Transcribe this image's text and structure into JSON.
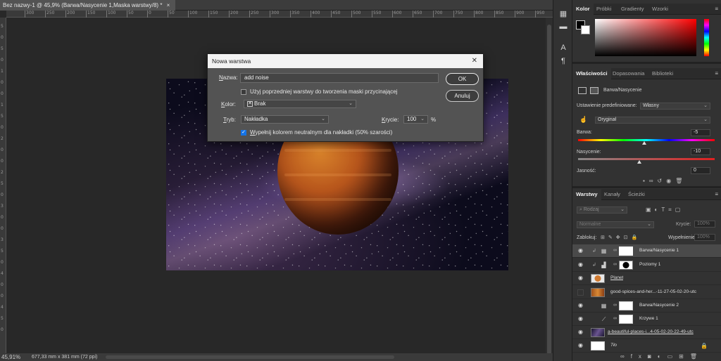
{
  "document": {
    "tab_title": "Bez nazwy-1 @ 45,9% (Barwa/Nasycenie 1,Maska warstwy/8) *",
    "tab_close": "×",
    "ruler_h": [
      "300",
      "250",
      "200",
      "150",
      "100",
      "50",
      "0",
      "50",
      "100",
      "150",
      "200",
      "250",
      "300",
      "350",
      "400",
      "450",
      "500",
      "550",
      "600",
      "650",
      "700",
      "750",
      "800",
      "850",
      "900",
      "950"
    ],
    "ruler_v": [
      "5",
      "0",
      "5",
      "0",
      "1",
      "0",
      "0",
      "1",
      "5",
      "0",
      "2",
      "0",
      "0",
      "2",
      "5",
      "0",
      "3",
      "0",
      "0",
      "3",
      "5",
      "0",
      "4",
      "0",
      "0",
      "4",
      "5",
      "0"
    ],
    "zoom": "45,91%",
    "doc_size": "677,33 mm x 381 mm (72 ppi)"
  },
  "dialog": {
    "title": "Nowa warstwa",
    "close": "✕",
    "name_label_u": "N",
    "name_label_rest": "azwa:",
    "name_value": "add noise",
    "clip_checkbox_label": "Użyj poprzedniej warstwy do tworzenia maski przycinającej",
    "color_label_u": "K",
    "color_label_rest": "olor:",
    "color_value": "Brak",
    "mode_label_u": "T",
    "mode_label_rest": "ryb:",
    "mode_value": "Nakładka",
    "opacity_label_u": "K",
    "opacity_label_rest": "rycie:",
    "opacity_value": "100",
    "opacity_unit": "%",
    "fill_checkbox_u": "W",
    "fill_checkbox_rest": "ypełnij kolorem neutralnym dla nakładki (50% szarości)",
    "ok": "OK",
    "cancel": "Anuluj"
  },
  "color_panel": {
    "tabs": [
      "Kolor",
      "Próbki",
      "Gradienty",
      "Wzorki"
    ]
  },
  "properties_panel": {
    "tabs": [
      "Właściwości",
      "Dopasowania",
      "Biblioteki"
    ],
    "layer_type": "Barwa/Nasycenie",
    "preset_label": "Ustawienie predefiniowane:",
    "preset_value": "Własny",
    "channel_value": "Oryginał",
    "hue_label": "Barwa:",
    "hue_value": "-5",
    "hue_level": -5,
    "sat_label": "Nasycenie:",
    "sat_value": "-10",
    "sat_level": -10,
    "light_label": "Jasność:",
    "light_value": "0"
  },
  "layers_panel": {
    "tabs": [
      "Warstwy",
      "Kanały",
      "Ścieżki"
    ],
    "filter_placeholder": "Rodzaj",
    "blend_mode": "Normalne",
    "opacity_label": "Krycie:",
    "opacity_value": "100%",
    "lock_label": "Zablokuj:",
    "fill_label": "Wypełnienie:",
    "fill_value": "100%",
    "layers": [
      {
        "name": "Barwa/Nasycenie 1",
        "visible": true,
        "selected": true
      },
      {
        "name": "Poziomy 1",
        "visible": true,
        "selected": false
      },
      {
        "name": "Planet",
        "visible": true,
        "selected": false
      },
      {
        "name": "good-spices-and-her...-11-27-05-02-20-utc",
        "visible": false,
        "selected": false
      },
      {
        "name": "Barwa/Nasycenie 2",
        "visible": true,
        "selected": false
      },
      {
        "name": "Krzywe 1",
        "visible": true,
        "selected": false
      },
      {
        "name": "a-beautiful-places-i...4-05-02-20-22-49-utc",
        "visible": true,
        "selected": false
      },
      {
        "name": "Tło",
        "visible": true,
        "selected": false
      }
    ]
  },
  "icons": {
    "eye": "◉",
    "menu": "≡",
    "dropdown": "⌄"
  }
}
